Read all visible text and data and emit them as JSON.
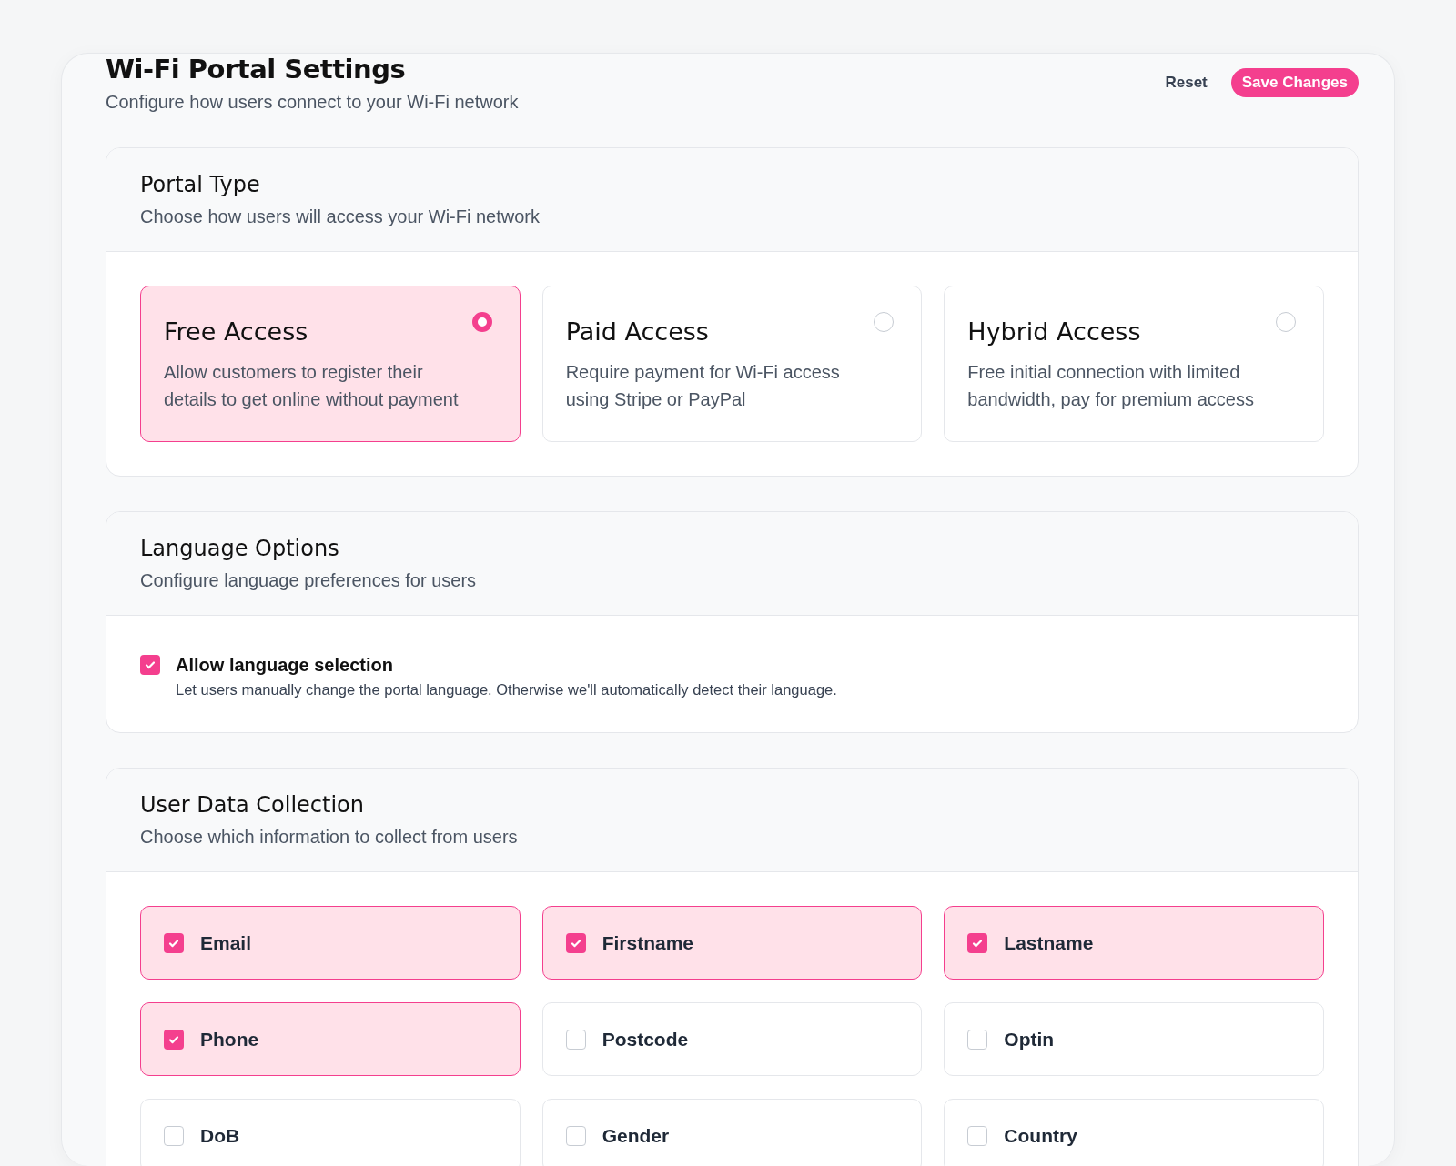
{
  "header": {
    "title": "Wi-Fi Portal Settings",
    "subtitle": "Configure how users connect to your Wi-Fi network",
    "reset": "Reset",
    "save": "Save Changes"
  },
  "portal_type": {
    "title": "Portal Type",
    "subtitle": "Choose how users will access your Wi-Fi network",
    "options": [
      {
        "title": "Free Access",
        "description": "Allow customers to register their details to get online without payment",
        "selected": true
      },
      {
        "title": "Paid Access",
        "description": "Require payment for Wi-Fi access using Stripe or PayPal",
        "selected": false
      },
      {
        "title": "Hybrid Access",
        "description": "Free initial connection with limited bandwidth, pay for premium access",
        "selected": false
      }
    ]
  },
  "language_options": {
    "title": "Language Options",
    "subtitle": "Configure language preferences for users",
    "setting": {
      "label": "Allow language selection",
      "description": "Let users manually change the portal language. Otherwise we'll automatically detect their language.",
      "checked": true
    }
  },
  "user_data_collection": {
    "title": "User Data Collection",
    "subtitle": "Choose which information to collect from users",
    "fields": [
      {
        "label": "Email",
        "checked": true
      },
      {
        "label": "Firstname",
        "checked": true
      },
      {
        "label": "Lastname",
        "checked": true
      },
      {
        "label": "Phone",
        "checked": true
      },
      {
        "label": "Postcode",
        "checked": false
      },
      {
        "label": "Optin",
        "checked": false
      },
      {
        "label": "DoB",
        "checked": false
      },
      {
        "label": "Gender",
        "checked": false
      },
      {
        "label": "Country",
        "checked": false
      }
    ]
  }
}
